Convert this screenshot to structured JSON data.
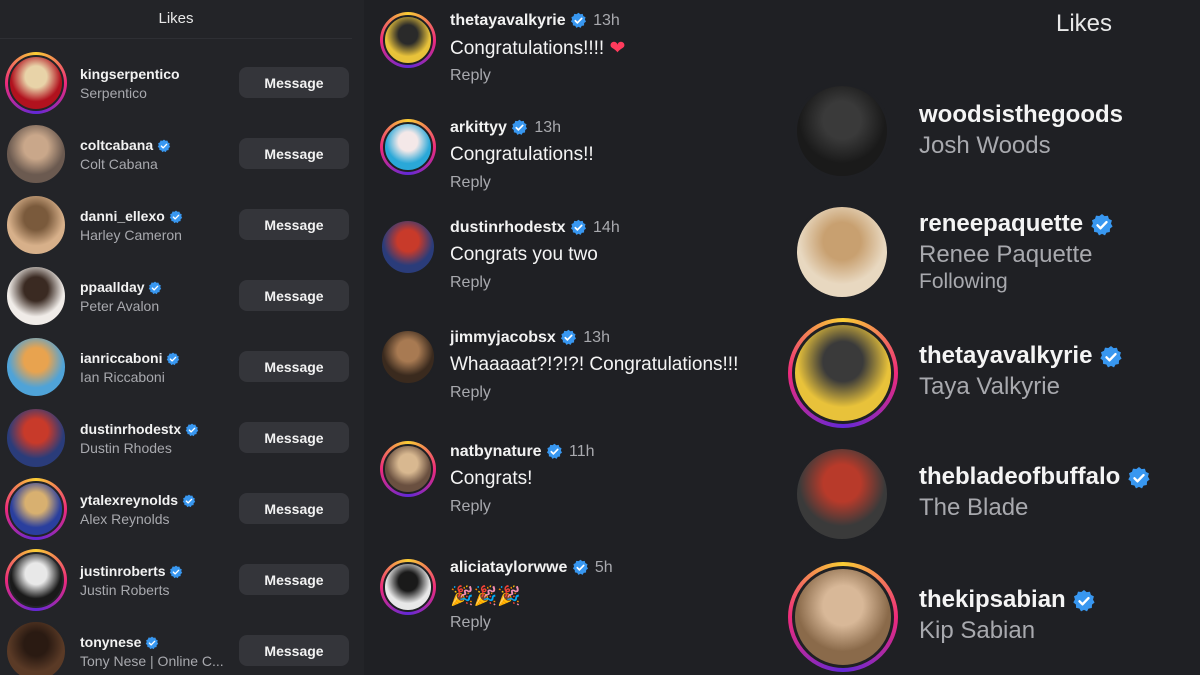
{
  "left_panel": {
    "title": "Likes",
    "message_label": "Message",
    "items": [
      {
        "username": "kingserpentico",
        "name": "Serpentico",
        "verified": false,
        "ring": true,
        "colors": [
          "#b1121e",
          "#e8d3a8"
        ]
      },
      {
        "username": "coltcabana",
        "name": "Colt Cabana",
        "verified": true,
        "ring": false,
        "colors": [
          "#6b5a50",
          "#c9a78a"
        ]
      },
      {
        "username": "danni_ellexo",
        "name": "Harley Cameron",
        "verified": true,
        "ring": false,
        "colors": [
          "#d7b08a",
          "#7a5a3c"
        ]
      },
      {
        "username": "ppaallday",
        "name": "Peter Avalon",
        "verified": true,
        "ring": false,
        "colors": [
          "#f0ece8",
          "#3a2a22"
        ]
      },
      {
        "username": "ianriccaboni",
        "name": "Ian Riccaboni",
        "verified": true,
        "ring": false,
        "colors": [
          "#4fa3d8",
          "#e8a34f"
        ]
      },
      {
        "username": "dustinrhodestx",
        "name": "Dustin Rhodes",
        "verified": true,
        "ring": false,
        "colors": [
          "#2a3c7a",
          "#c83a2a"
        ]
      },
      {
        "username": "ytalexreynolds",
        "name": "Alex Reynolds",
        "verified": true,
        "ring": true,
        "colors": [
          "#2a3f9e",
          "#d8b070"
        ]
      },
      {
        "username": "justinroberts",
        "name": "Justin Roberts",
        "verified": true,
        "ring": true,
        "colors": [
          "#1a1a1a",
          "#e8e8e8"
        ]
      },
      {
        "username": "tonynese",
        "name": "Tony Nese | Online C...",
        "verified": true,
        "ring": false,
        "colors": [
          "#5a3a26",
          "#2a1a12"
        ]
      }
    ]
  },
  "comments_panel": {
    "reply_label": "Reply",
    "comments": [
      {
        "username": "thetayavalkyrie",
        "time": "13h",
        "text": "Congratulations!!!!",
        "heart": true,
        "ring": true,
        "colors": [
          "#e8c23a",
          "#2a2a2a"
        ]
      },
      {
        "username": "arkittyy",
        "time": "13h",
        "text": "Congratulations!!",
        "heart": false,
        "ring": true,
        "colors": [
          "#2aa8d8",
          "#f4e8e8"
        ]
      },
      {
        "username": "dustinrhodestx",
        "time": "14h",
        "text": "Congrats you two",
        "heart": false,
        "ring": false,
        "colors": [
          "#2a3c7a",
          "#c83a2a"
        ]
      },
      {
        "username": "jimmyjacobsx",
        "time": "13h",
        "text": "Whaaaaat?!?!?! Congratulations!!!",
        "heart": false,
        "ring": false,
        "colors": [
          "#3a2a1e",
          "#a87a52"
        ]
      },
      {
        "username": "natbynature",
        "time": "11h",
        "text": "Congrats!",
        "heart": false,
        "ring": true,
        "colors": [
          "#6a5040",
          "#d8b890"
        ]
      },
      {
        "username": "aliciataylorwwe",
        "time": "5h",
        "text": "🎉🎉🎉",
        "heart": false,
        "ring": true,
        "colors": [
          "#e8e8e8",
          "#1a1a1a"
        ]
      }
    ]
  },
  "right_panel": {
    "title": "Likes",
    "items": [
      {
        "username": "woodsisthegoods",
        "name": "Josh Woods",
        "status": "",
        "verified": false,
        "ring": false,
        "colors": [
          "#1a1a1a",
          "#3a3a3a"
        ]
      },
      {
        "username": "reneepaquette",
        "name": "Renee Paquette",
        "status": "Following",
        "verified": true,
        "ring": false,
        "colors": [
          "#e8d8c0",
          "#c8a070"
        ]
      },
      {
        "username": "thetayavalkyrie",
        "name": "Taya Valkyrie",
        "status": "",
        "verified": true,
        "ring": true,
        "colors": [
          "#e8c23a",
          "#3a3a3a"
        ]
      },
      {
        "username": "thebladeofbuffalo",
        "name": "The Blade",
        "status": "",
        "verified": true,
        "ring": false,
        "colors": [
          "#3a3a3a",
          "#b83a2a"
        ]
      },
      {
        "username": "thekipsabian",
        "name": "Kip Sabian",
        "status": "",
        "verified": true,
        "ring": true,
        "colors": [
          "#8a6a4a",
          "#d8b898"
        ]
      }
    ]
  },
  "colors": {
    "background": "#1e1f24",
    "verified_badge": "#3897f0",
    "muted_text": "#a8a9ae",
    "button_bg": "#34353a"
  }
}
